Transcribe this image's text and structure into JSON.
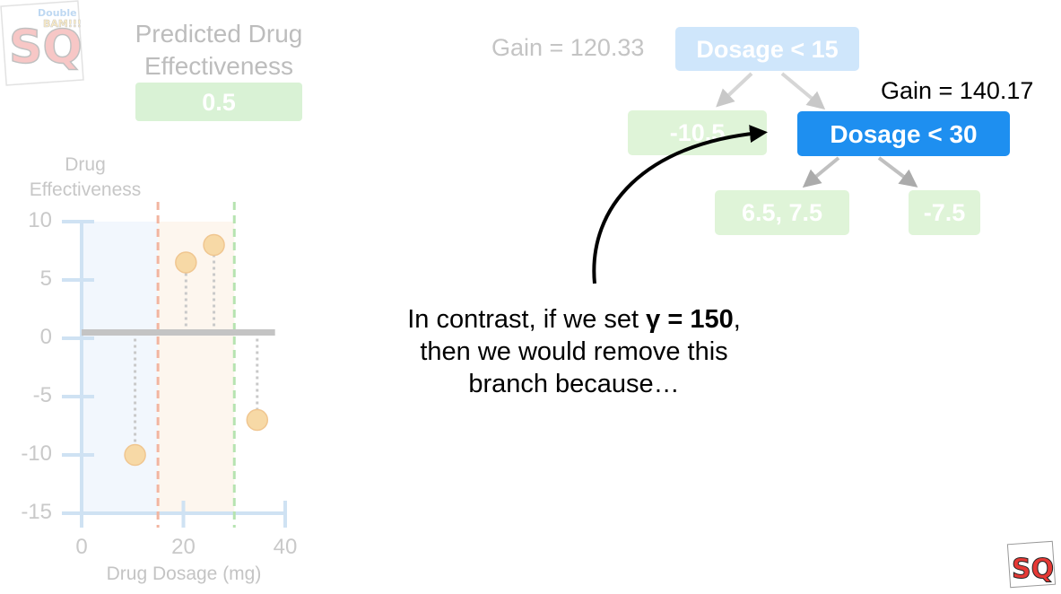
{
  "logo": {
    "mark": "SQ!",
    "tagline": "BAM!!!",
    "kicker": "Double"
  },
  "prediction": {
    "title_line1": "Predicted Drug",
    "title_line2": "Effectiveness",
    "value": "0.5"
  },
  "chart_data": {
    "type": "scatter",
    "title": "",
    "ylabel_line1": "Drug",
    "ylabel_line2": "Effectiveness",
    "xlabel": "Drug Dosage (mg)",
    "xlim": [
      0,
      40
    ],
    "ylim": [
      -15,
      10
    ],
    "x_ticks": [
      "0",
      "20",
      "40"
    ],
    "y_ticks": [
      "10",
      "5",
      "0",
      "-5",
      "-10",
      "-15"
    ],
    "points": [
      {
        "x": 10.5,
        "y": -10
      },
      {
        "x": 20.5,
        "y": 6.5
      },
      {
        "x": 26,
        "y": 8
      },
      {
        "x": 34.5,
        "y": -7
      }
    ],
    "prediction_line_y": 0.5,
    "thresholds": [
      {
        "x": 15,
        "color": "#f2b5a0"
      },
      {
        "x": 30,
        "color": "#b6e3b0"
      }
    ],
    "grid": false
  },
  "tree": {
    "root": {
      "label": "Dosage < 15",
      "gain": "Gain = 120.33"
    },
    "left_leaf": "-10.5",
    "right_node": {
      "label": "Dosage < 30",
      "gain": "Gain = 140.17"
    },
    "right_left_leaf": "6.5, 7.5",
    "right_right_leaf": "-7.5"
  },
  "caption": {
    "line1_prefix": "In contrast, if we set ",
    "gamma": "γ = 150",
    "line1_suffix": ",",
    "line2": "then we would remove this",
    "line3": "branch because…"
  },
  "colors": {
    "node_active": "#1e8ff0",
    "axis": "#b9d8f0",
    "point": "#f7d9a6"
  }
}
